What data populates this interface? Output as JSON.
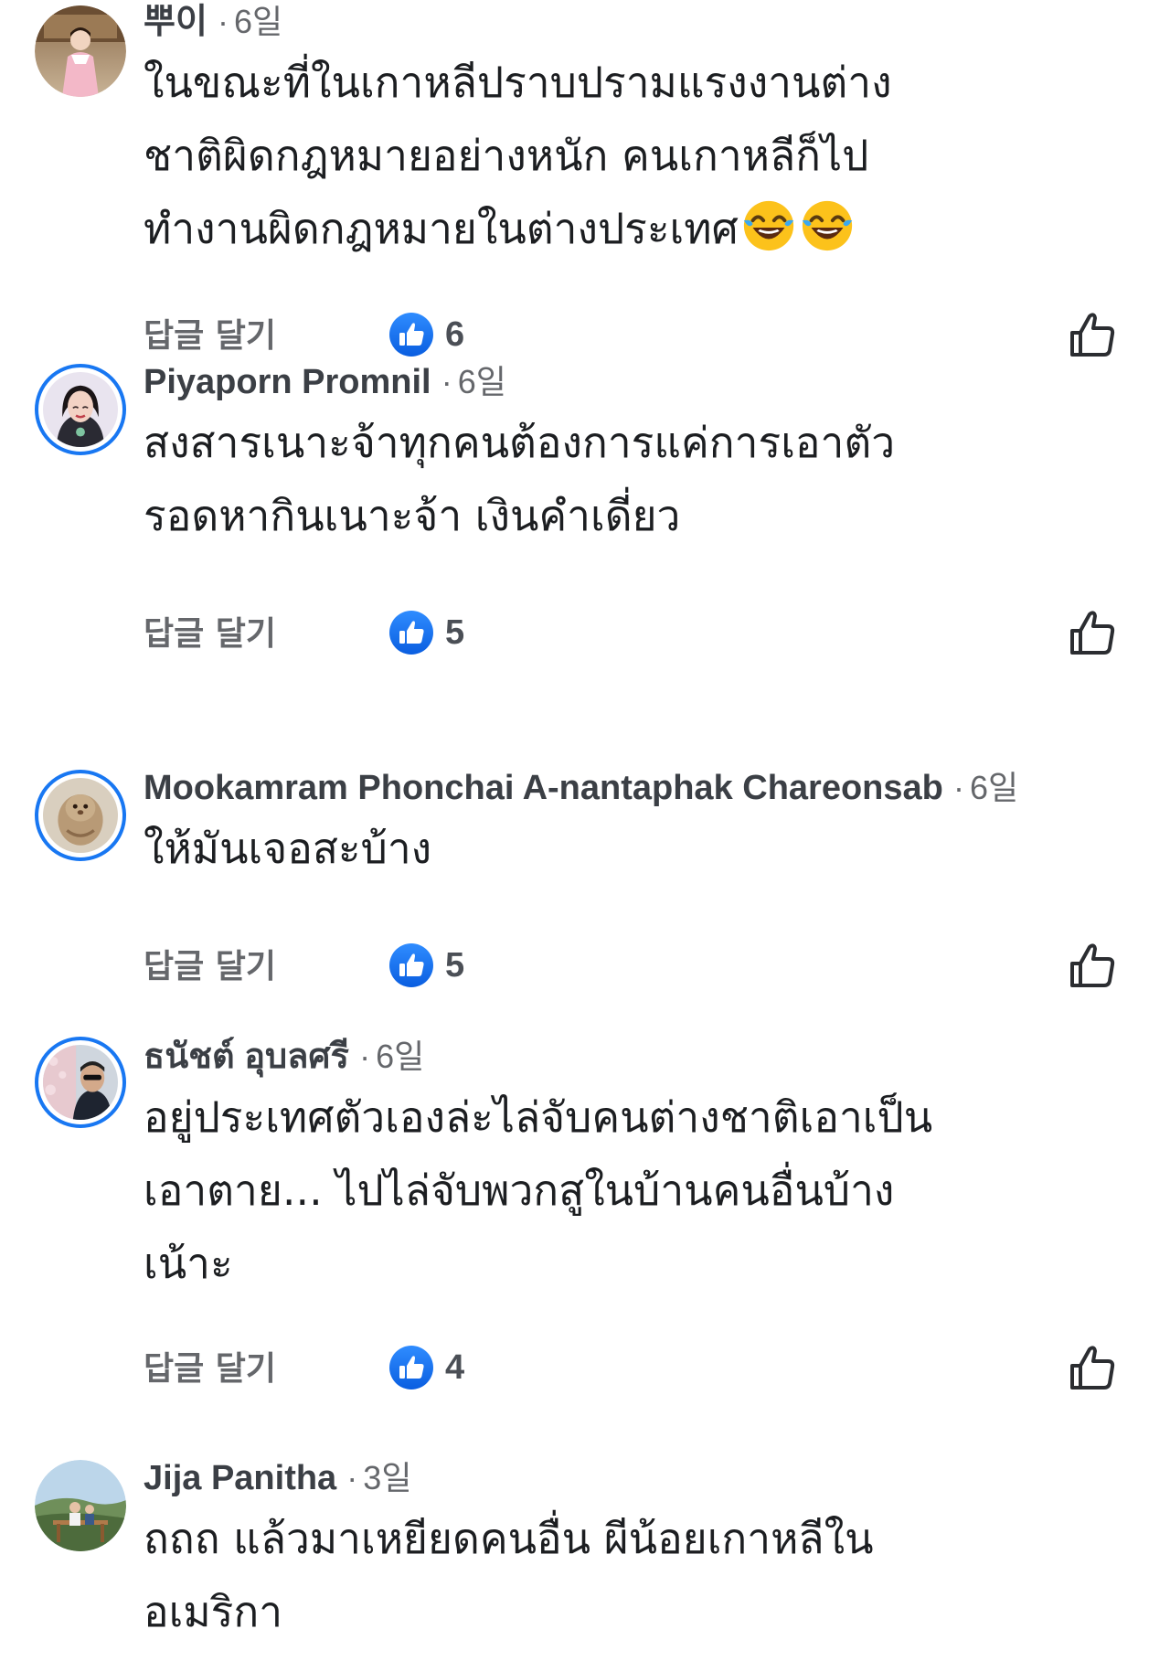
{
  "comments": [
    {
      "name": "뿌이",
      "time": "6일",
      "lines": [
        "ในขณะที่ในเกาหลีปราบปรามแรงงานต่าง",
        "ชาติผิดกฎหมายอย่างหนัก คนเกาหลีก็ไป",
        "ทำงานผิดกฎหมายในต่างประเทศ"
      ],
      "trailing_emoji": [
        "face-with-tears-of-joy-icon",
        "face-with-tears-of-joy-icon"
      ],
      "reply_label": "답글 달기",
      "reaction_icon": "like-reaction-icon",
      "reaction_count": "6",
      "avatar": "profile-photo"
    },
    {
      "name": "Piyaporn Promnil",
      "time": "6일",
      "lines": [
        "สงสารเนาะจ้าทุกคนต้องการแค่การเอาตัว",
        "รอดหากินเนาะจ้า เงินคำเดี่ยว"
      ],
      "reply_label": "답글 달기",
      "reaction_icon": "like-reaction-icon",
      "reaction_count": "5",
      "avatar": "profile-photo-story-ring"
    },
    {
      "name": "Mookamram Phonchai A-nantaphak Chareonsab",
      "time": "6일",
      "lines": [
        "ให้มันเจอสะบ้าง"
      ],
      "reply_label": "답글 달기",
      "reaction_icon": "like-reaction-icon",
      "reaction_count": "5",
      "avatar": "profile-photo-story-ring"
    },
    {
      "name": "ธนัชต์ อุบลศรี",
      "time": "6일",
      "lines": [
        "อยู่ประเทศตัวเองล่ะไล่จับคนต่างชาติเอาเป็น",
        "เอาตาย... ไปไล่จับพวกสูในบ้านคนอื่นบ้าง",
        "เน้าะ"
      ],
      "reply_label": "답글 달기",
      "reaction_icon": "like-reaction-icon",
      "reaction_count": "4",
      "avatar": "profile-photo-story-ring"
    },
    {
      "name": "Jija Panitha",
      "time": "3일",
      "lines": [
        "ถถถ แล้วมาเหยียดคนอื่น ผีน้อยเกาหลีใน",
        "อเมริกา"
      ],
      "avatar": "profile-photo"
    }
  ],
  "colors": {
    "facebook_blue": "#1877f2",
    "meta_gray": "#65676b",
    "text": "#1c1e21"
  }
}
